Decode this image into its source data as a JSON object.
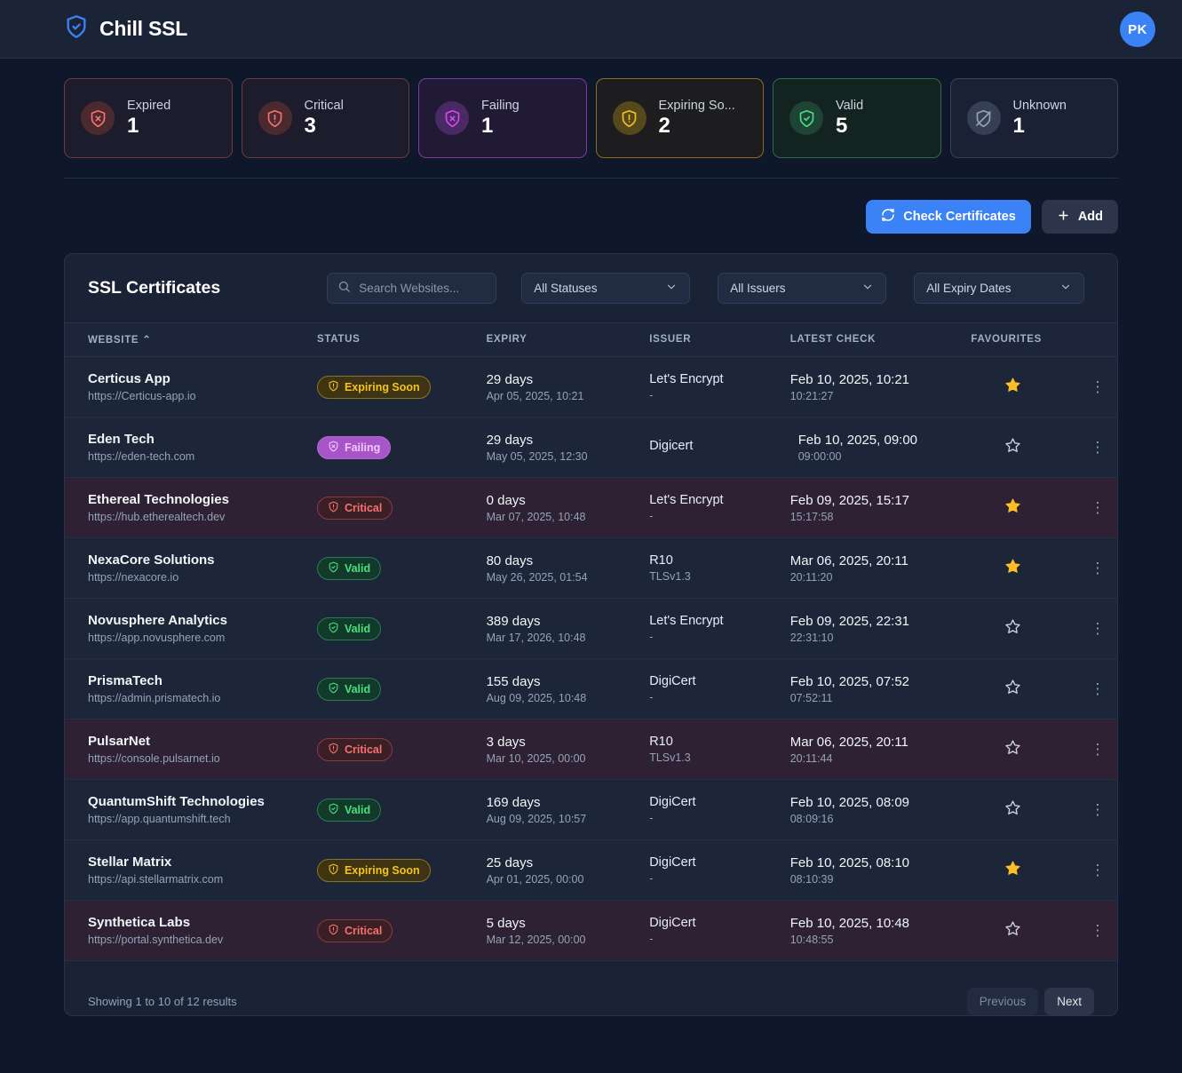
{
  "app": {
    "brand_name": "Chill SSL",
    "brand_icon": "shield-check-icon",
    "avatar_initials": "PK"
  },
  "stats": [
    {
      "label": "Expired",
      "value": "1",
      "icon": "shield-x-icon",
      "accent": "#f87171",
      "bg": "#1c1c2c",
      "border": "#6b3a3f",
      "icon_bg": "#4a2a2e"
    },
    {
      "label": "Critical",
      "value": "3",
      "icon": "shield-alert-icon",
      "accent": "#f87171",
      "bg": "#1c1c2c",
      "border": "#6b3a3f",
      "icon_bg": "#4a2a2e"
    },
    {
      "label": "Failing",
      "value": "1",
      "icon": "shield-x-icon",
      "accent": "#d946ef",
      "bg": "#201a34",
      "border": "#7b3c9e",
      "icon_bg": "#4a2a64"
    },
    {
      "label": "Expiring So...",
      "value": "2",
      "icon": "shield-warning-icon",
      "accent": "#fbbf24",
      "bg": "#1d1c1e",
      "border": "#8a6d1f",
      "icon_bg": "#55481a"
    },
    {
      "label": "Valid",
      "value": "5",
      "icon": "shield-check-icon",
      "accent": "#4ade80",
      "bg": "#132320",
      "border": "#2f6b4d",
      "icon_bg": "#1d4434"
    },
    {
      "label": "Unknown",
      "value": "1",
      "icon": "shield-off-icon",
      "accent": "#94a3b8",
      "bg": "#1a2134",
      "border": "#384258",
      "icon_bg": "#353f55"
    }
  ],
  "toolbar": {
    "check_label": "Check Certificates",
    "check_icon": "refresh-icon",
    "add_label": "Add",
    "add_icon": "plus-icon"
  },
  "table_panel": {
    "title": "SSL Certificates",
    "search_placeholder": "Search Websites...",
    "search_value": "",
    "search_icon": "search-icon",
    "filters": [
      {
        "name": "status",
        "selected": "All Statuses"
      },
      {
        "name": "issuer",
        "selected": "All Issuers"
      },
      {
        "name": "expiry",
        "selected": "All Expiry Dates"
      }
    ],
    "columns": [
      "WEBSITE",
      "STATUS",
      "EXPIRY",
      "ISSUER",
      "LATEST CHECK",
      "FAVOURITES"
    ],
    "sort_indicator": "⌃"
  },
  "rows": [
    {
      "site": "Certicus App",
      "url": "https://Certicus-app.io",
      "status": "Expiring Soon",
      "status_kind": "expiring",
      "expiry_days": "29 days",
      "expiry_date": "Apr 05, 2025, 10:21",
      "issuer": "Let's Encrypt",
      "issuer_sub": "-",
      "check_date": "Feb 10, 2025, 10:21",
      "check_time": "10:21:27",
      "favourite": true,
      "row_kind": "normal",
      "offset": false
    },
    {
      "site": "Eden Tech",
      "url": "https://eden-tech.com",
      "status": "Failing",
      "status_kind": "failing",
      "expiry_days": "29 days",
      "expiry_date": "May 05, 2025, 12:30",
      "issuer": "Digicert",
      "issuer_sub": "",
      "check_date": "Feb 10, 2025, 09:00",
      "check_time": "09:00:00",
      "favourite": false,
      "row_kind": "normal",
      "offset": true
    },
    {
      "site": "Ethereal Technologies",
      "url": "https://hub.etherealtech.dev",
      "status": "Critical",
      "status_kind": "critical",
      "expiry_days": "0 days",
      "expiry_date": "Mar 07, 2025, 10:48",
      "issuer": "Let's Encrypt",
      "issuer_sub": "-",
      "check_date": "Feb 09, 2025, 15:17",
      "check_time": "15:17:58",
      "favourite": true,
      "row_kind": "critical",
      "offset": false
    },
    {
      "site": "NexaCore Solutions",
      "url": "https://nexacore.io",
      "status": "Valid",
      "status_kind": "valid",
      "expiry_days": "80 days",
      "expiry_date": "May 26, 2025, 01:54",
      "issuer": "R10",
      "issuer_sub": "TLSv1.3",
      "check_date": "Mar 06, 2025, 20:11",
      "check_time": "20:11:20",
      "favourite": true,
      "row_kind": "normal",
      "offset": false
    },
    {
      "site": "Novusphere Analytics",
      "url": "https://app.novusphere.com",
      "status": "Valid",
      "status_kind": "valid",
      "expiry_days": "389 days",
      "expiry_date": "Mar 17, 2026, 10:48",
      "issuer": "Let's Encrypt",
      "issuer_sub": "-",
      "check_date": "Feb 09, 2025, 22:31",
      "check_time": "22:31:10",
      "favourite": false,
      "row_kind": "normal",
      "offset": false
    },
    {
      "site": "PrismaTech",
      "url": "https://admin.prismatech.io",
      "status": "Valid",
      "status_kind": "valid",
      "expiry_days": "155 days",
      "expiry_date": "Aug 09, 2025, 10:48",
      "issuer": "DigiCert",
      "issuer_sub": "-",
      "check_date": "Feb 10, 2025, 07:52",
      "check_time": "07:52:11",
      "favourite": false,
      "row_kind": "normal",
      "offset": false
    },
    {
      "site": "PulsarNet",
      "url": "https://console.pulsarnet.io",
      "status": "Critical",
      "status_kind": "critical",
      "expiry_days": "3 days",
      "expiry_date": "Mar 10, 2025, 00:00",
      "issuer": "R10",
      "issuer_sub": "TLSv1.3",
      "check_date": "Mar 06, 2025, 20:11",
      "check_time": "20:11:44",
      "favourite": false,
      "row_kind": "critical",
      "offset": false
    },
    {
      "site": "QuantumShift Technologies",
      "url": "https://app.quantumshift.tech",
      "status": "Valid",
      "status_kind": "valid",
      "expiry_days": "169 days",
      "expiry_date": "Aug 09, 2025, 10:57",
      "issuer": "DigiCert",
      "issuer_sub": "-",
      "check_date": "Feb 10, 2025, 08:09",
      "check_time": "08:09:16",
      "favourite": false,
      "row_kind": "normal",
      "offset": false
    },
    {
      "site": "Stellar Matrix",
      "url": "https://api.stellarmatrix.com",
      "status": "Expiring Soon",
      "status_kind": "expiring",
      "expiry_days": "25 days",
      "expiry_date": "Apr 01, 2025, 00:00",
      "issuer": "DigiCert",
      "issuer_sub": "-",
      "check_date": "Feb 10, 2025, 08:10",
      "check_time": "08:10:39",
      "favourite": true,
      "row_kind": "normal",
      "offset": false
    },
    {
      "site": "Synthetica Labs",
      "url": "https://portal.synthetica.dev",
      "status": "Critical",
      "status_kind": "critical",
      "expiry_days": "5 days",
      "expiry_date": "Mar 12, 2025, 00:00",
      "issuer": "DigiCert",
      "issuer_sub": "-",
      "check_date": "Feb 10, 2025, 10:48",
      "check_time": "10:48:55",
      "favourite": false,
      "row_kind": "critical",
      "offset": false
    }
  ],
  "footer": {
    "results_text": "Showing 1 to 10 of 12 results",
    "previous_label": "Previous",
    "next_label": "Next"
  }
}
